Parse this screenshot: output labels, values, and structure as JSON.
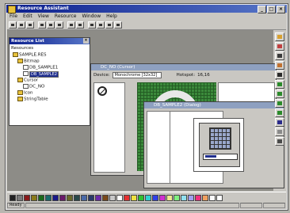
{
  "window": {
    "title": "Resource Assistant",
    "controls": [
      "_",
      "□",
      "×"
    ]
  },
  "menu": [
    "File",
    "Edit",
    "View",
    "Resource",
    "Window",
    "Help"
  ],
  "toolbar": {
    "count": 13
  },
  "resource_list": {
    "title": "Resource List",
    "close": "×",
    "root_label": "Resources",
    "items": [
      {
        "label": "SAMPLE.RES",
        "icon": "folder-icon"
      },
      {
        "label": "Bitmap",
        "icon": "folder-icon"
      },
      {
        "label": "DB_SAMPLE1",
        "icon": "doc-icon"
      },
      {
        "label": "DB_SAMPLE2",
        "icon": "doc-icon",
        "selected": true
      },
      {
        "label": "Cursor",
        "icon": "folder-icon"
      },
      {
        "label": "DC_NO",
        "icon": "doc-icon"
      },
      {
        "label": "Icon",
        "icon": "folder-icon"
      },
      {
        "label": "StringTable",
        "icon": "folder-icon"
      }
    ]
  },
  "bitmap_editor": {
    "title": "DC_NO (Cursor)",
    "device_label": "Device:",
    "device_value": "Monochrome [32x32]",
    "hotspot_label": "Hotspot:",
    "hotspot_value": "16,16"
  },
  "dialog_editor": {
    "title": "DB_SAMPLE2 (Dialog)"
  },
  "palette": [
    "#222222",
    "#7a7a7a",
    "#8a1a1a",
    "#8a7a1a",
    "#1a6a1a",
    "#1a6a6a",
    "#1a1a8a",
    "#6a1a6a",
    "#6a6a2a",
    "#2a4a4a",
    "#4a6aa8",
    "#2a3a6a",
    "#6a2aa8",
    "#7a4a1a",
    "#c8c8c8",
    "#ffffff",
    "#e63030",
    "#f0e040",
    "#30c030",
    "#30d0d0",
    "#3040e8",
    "#d030d0",
    "#f0e890",
    "#80f080",
    "#90e0f0",
    "#a0a0f0",
    "#f03080",
    "#f0a060",
    "#fafafa",
    "#ffffff"
  ],
  "status": [
    "Ready",
    "",
    "",
    ""
  ],
  "right_tools": [
    {
      "name": "pencil-tool-icon",
      "color": "#d8a030"
    },
    {
      "name": "fill-tool-icon",
      "color": "#c04040"
    },
    {
      "name": "pen-tool-icon",
      "color": "#3a3a3a"
    },
    {
      "name": "brush-tool-icon",
      "color": "#c07030"
    },
    {
      "name": "line-tool-icon",
      "color": "#2a2a2a"
    },
    {
      "name": "rect-tool-icon",
      "color": "#2a8a2a"
    },
    {
      "name": "filled-rect-tool-icon",
      "color": "#2a8a2a"
    },
    {
      "name": "ellipse-tool-icon",
      "color": "#2a8a2a"
    },
    {
      "name": "filled-ellipse-tool-icon",
      "color": "#2a8a2a"
    },
    {
      "name": "select-tool-icon",
      "color": "#2a2a8a"
    },
    {
      "name": "eraser-tool-icon",
      "color": "#8a8a8a"
    },
    {
      "name": "text-tool-icon",
      "color": "#4a4a4a"
    }
  ]
}
